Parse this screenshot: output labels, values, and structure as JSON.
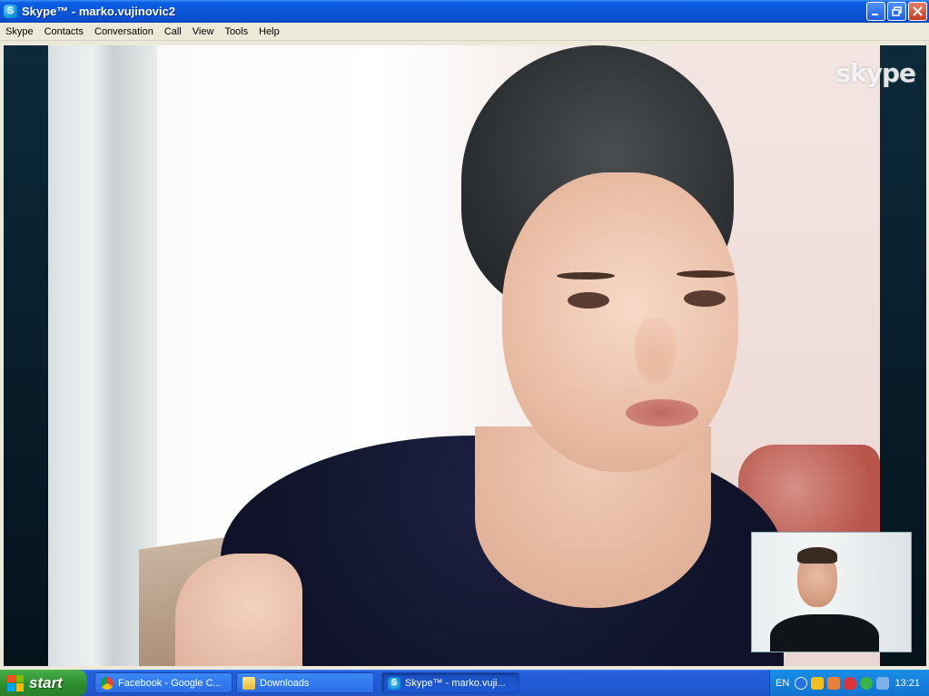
{
  "window": {
    "title": "Skype™ - marko.vujinovic2",
    "icon_letter": "S",
    "controls": {
      "minimize": "minimize-icon",
      "restore": "restore-icon",
      "close": "close-icon"
    }
  },
  "menu": {
    "items": [
      "Skype",
      "Contacts",
      "Conversation",
      "Call",
      "View",
      "Tools",
      "Help"
    ]
  },
  "video": {
    "watermark": "skype"
  },
  "taskbar": {
    "start_label": "start",
    "tasks": [
      {
        "label": "Facebook - Google C...",
        "icon": "chrome-icon"
      },
      {
        "label": "Downloads",
        "icon": "folder-icon"
      },
      {
        "label": "Skype™ - marko.vuji...",
        "icon": "skype-icon"
      }
    ],
    "tray": {
      "language": "EN",
      "clock": "13:21"
    }
  }
}
